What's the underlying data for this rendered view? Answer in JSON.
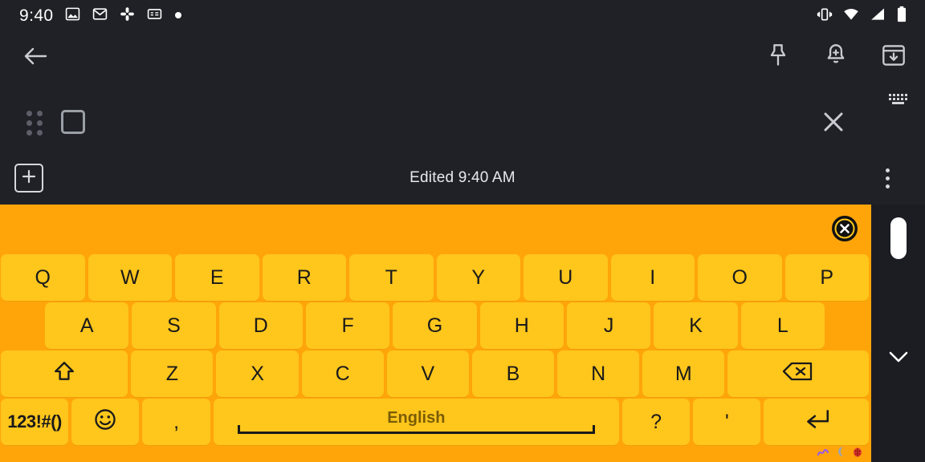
{
  "status_bar": {
    "time": "9:40",
    "left_icons": [
      "photos-icon",
      "gmail-icon",
      "slack-icon",
      "google-news-icon",
      "dot-icon"
    ],
    "right_icons": [
      "vibrate-icon",
      "wifi-icon",
      "cellular-signal-icon",
      "battery-icon"
    ]
  },
  "app_bar": {
    "back_icon": "back-arrow-icon",
    "actions": [
      {
        "name": "pin-icon",
        "label": "Pin"
      },
      {
        "name": "reminder-bell-icon",
        "label": "Remind me"
      },
      {
        "name": "archive-icon",
        "label": "Archive"
      }
    ]
  },
  "edit_row": {
    "drag_handle": "drag-handle-icon",
    "checkbox": "square-checkbox-icon",
    "close": "close-icon",
    "keyboard_toggle": "keyboard-icon"
  },
  "note_bar": {
    "add_label": "+",
    "edited_text": "Edited 9:40 AM",
    "overflow": "more-options-icon"
  },
  "keyboard": {
    "background_color": "#ffa50a",
    "key_color": "#ffc61c",
    "key_text_color": "#1a1a1a",
    "suggestion_strip": {
      "clear_icon": "clear-suggestions-icon",
      "suggestions": []
    },
    "rows": [
      {
        "id": "row1",
        "keys": [
          {
            "label": "Q",
            "name": "key-q"
          },
          {
            "label": "W",
            "name": "key-w"
          },
          {
            "label": "E",
            "name": "key-e"
          },
          {
            "label": "R",
            "name": "key-r"
          },
          {
            "label": "T",
            "name": "key-t"
          },
          {
            "label": "Y",
            "name": "key-y"
          },
          {
            "label": "U",
            "name": "key-u"
          },
          {
            "label": "I",
            "name": "key-i"
          },
          {
            "label": "O",
            "name": "key-o"
          },
          {
            "label": "P",
            "name": "key-p"
          }
        ]
      },
      {
        "id": "row2",
        "keys": [
          {
            "label": "A",
            "name": "key-a"
          },
          {
            "label": "S",
            "name": "key-s"
          },
          {
            "label": "D",
            "name": "key-d"
          },
          {
            "label": "F",
            "name": "key-f"
          },
          {
            "label": "G",
            "name": "key-g"
          },
          {
            "label": "H",
            "name": "key-h"
          },
          {
            "label": "J",
            "name": "key-j"
          },
          {
            "label": "K",
            "name": "key-k"
          },
          {
            "label": "L",
            "name": "key-l"
          }
        ]
      },
      {
        "id": "row3",
        "keys": [
          {
            "label": "",
            "name": "key-shift",
            "icon": "shift-icon"
          },
          {
            "label": "Z",
            "name": "key-z"
          },
          {
            "label": "X",
            "name": "key-x"
          },
          {
            "label": "C",
            "name": "key-c"
          },
          {
            "label": "V",
            "name": "key-v"
          },
          {
            "label": "B",
            "name": "key-b"
          },
          {
            "label": "N",
            "name": "key-n"
          },
          {
            "label": "M",
            "name": "key-m"
          },
          {
            "label": "",
            "name": "key-backspace",
            "icon": "backspace-icon"
          }
        ]
      },
      {
        "id": "row4",
        "keys": [
          {
            "label": "123!#()",
            "name": "key-symbols"
          },
          {
            "label": "",
            "name": "key-emoji",
            "icon": "emoji-smiley-icon"
          },
          {
            "label": ",",
            "name": "key-comma"
          },
          {
            "label": "English",
            "name": "key-space"
          },
          {
            "label": "?",
            "name": "key-question"
          },
          {
            "label": "'",
            "name": "key-apostrophe"
          },
          {
            "label": "",
            "name": "key-enter",
            "icon": "enter-icon"
          }
        ]
      }
    ],
    "mini_icons": [
      "squiggle-icon",
      "moon-icon",
      "ladybug-icon"
    ]
  },
  "right_strip": {
    "handle": "drag-pill-handle",
    "chevron": "chevron-down-icon"
  }
}
